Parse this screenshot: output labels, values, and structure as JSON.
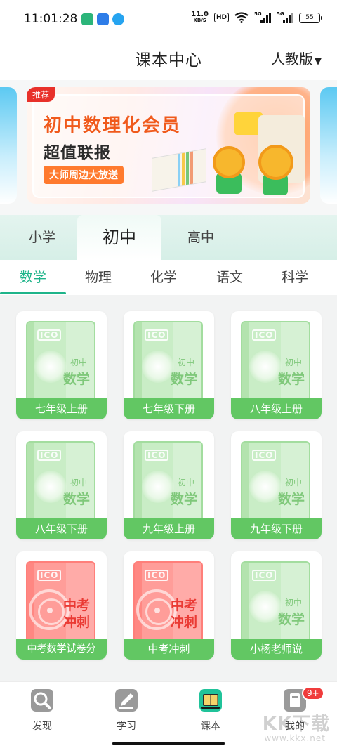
{
  "status_bar": {
    "time": "11:01:28",
    "net_speed_value": "11.0",
    "net_speed_unit": "KB/S",
    "hd_label": "HD",
    "sim1": "5G",
    "sim2": "5G",
    "battery": "55"
  },
  "header": {
    "title": "课本中心",
    "edition": "人教版",
    "edition_caret": "▼"
  },
  "banner": {
    "tag": "推荐",
    "headline": "初中数理化会员",
    "subline": "超值联报",
    "pill": "大师周边大放送"
  },
  "level_tabs": [
    {
      "label": "小学",
      "active": false
    },
    {
      "label": "初中",
      "active": true
    },
    {
      "label": "高中",
      "active": false
    }
  ],
  "subject_tabs": [
    {
      "label": "数学",
      "active": true
    },
    {
      "label": "物理",
      "active": false
    },
    {
      "label": "化学",
      "active": false
    },
    {
      "label": "语文",
      "active": false
    },
    {
      "label": "科学",
      "active": false
    }
  ],
  "books": [
    {
      "label": "七年级上册",
      "style": "green",
      "cover_small": "初中",
      "cover_big": "数学"
    },
    {
      "label": "七年级下册",
      "style": "green",
      "cover_small": "初中",
      "cover_big": "数学"
    },
    {
      "label": "八年级上册",
      "style": "green",
      "cover_small": "初中",
      "cover_big": "数学"
    },
    {
      "label": "八年级下册",
      "style": "green",
      "cover_small": "初中",
      "cover_big": "数学"
    },
    {
      "label": "九年级上册",
      "style": "green",
      "cover_small": "初中",
      "cover_big": "数学"
    },
    {
      "label": "九年级下册",
      "style": "green",
      "cover_small": "初中",
      "cover_big": "数学"
    },
    {
      "label": "中考数学试卷分",
      "style": "red",
      "cover_line1": "中考",
      "cover_line2": "冲刺"
    },
    {
      "label": "中考冲刺",
      "style": "red",
      "cover_line1": "中考",
      "cover_line2": "冲刺"
    },
    {
      "label": "小杨老师说",
      "style": "green",
      "cover_small": "初中",
      "cover_big": "数学"
    }
  ],
  "cover_logo": "ICO",
  "bottom_nav": [
    {
      "label": "发现",
      "icon": "magnifier-icon"
    },
    {
      "label": "学习",
      "icon": "pen-icon"
    },
    {
      "label": "课本",
      "icon": "book-icon",
      "active": true
    },
    {
      "label": "我的",
      "icon": "profile-icon",
      "badge": "9+"
    }
  ],
  "watermark": {
    "text": "KK下载",
    "url": "www.kkx.net"
  },
  "colors": {
    "accent": "#1fb48a",
    "card_label_green": "#62c763",
    "cover_red": "#ff9d99",
    "banner_orange": "#f05a1c"
  }
}
